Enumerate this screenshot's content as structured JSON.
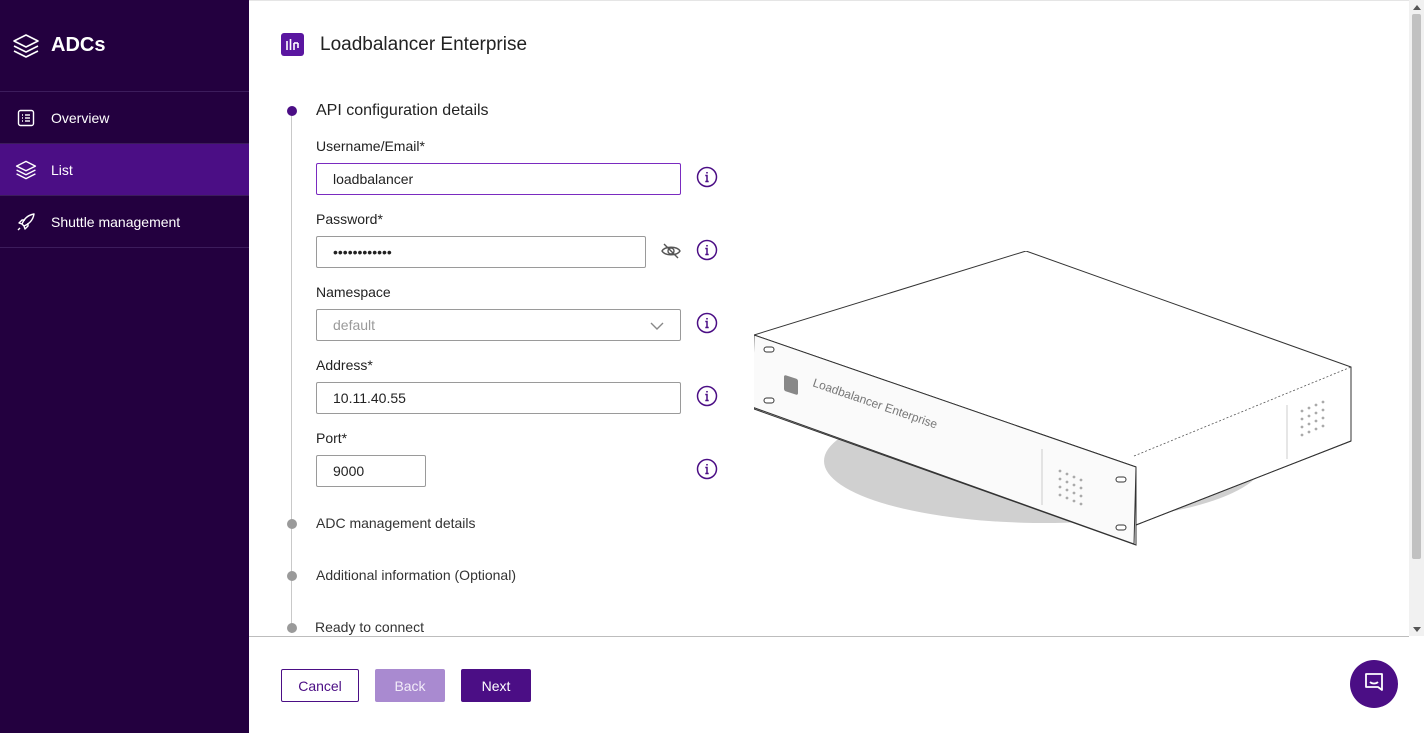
{
  "sidebar": {
    "title": "ADCs",
    "items": [
      {
        "label": "Overview",
        "icon": "list-icon",
        "active": false
      },
      {
        "label": "List",
        "icon": "layers-icon",
        "active": true
      },
      {
        "label": "Shuttle management",
        "icon": "rocket-icon",
        "active": false
      }
    ]
  },
  "header": {
    "title": "Loadbalancer Enterprise"
  },
  "steps": [
    {
      "title": "API configuration details",
      "active": true
    },
    {
      "title": "ADC management details",
      "active": false
    },
    {
      "title": "Additional information (Optional)",
      "active": false
    },
    {
      "title": "Ready to connect",
      "active": false
    }
  ],
  "form": {
    "username": {
      "label": "Username/Email*",
      "value": "loadbalancer"
    },
    "password": {
      "label": "Password*",
      "value": "••••••••••••"
    },
    "namespace": {
      "label": "Namespace",
      "value": "default"
    },
    "address": {
      "label": "Address*",
      "value": "10.11.40.55"
    },
    "port": {
      "label": "Port*",
      "value": "9000"
    }
  },
  "device": {
    "label": "Loadbalancer Enterprise"
  },
  "footer": {
    "cancel_label": "Cancel",
    "back_label": "Back",
    "next_label": "Next"
  },
  "colors": {
    "primary": "#4b0e85",
    "sidebar_bg": "#23003f",
    "active_nav": "#4b0e85",
    "disabled_button": "#a98ad0"
  }
}
